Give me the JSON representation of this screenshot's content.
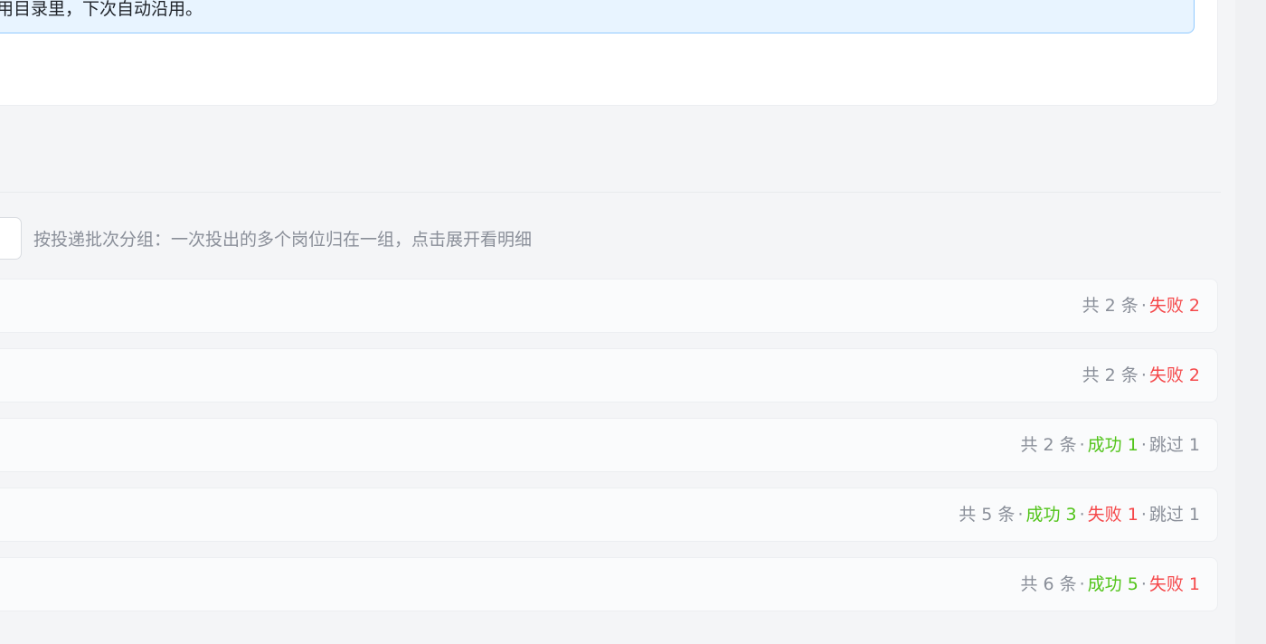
{
  "banner": {
    "text": "用目录里，下次自动沿用。"
  },
  "hint": {
    "text": "按投递批次分组：一次投出的多个岗位归在一组，点击展开看明细"
  },
  "colors": {
    "success": "#52c41a",
    "fail": "#f5484a",
    "muted": "#8a8f99",
    "banner_bg": "#e8f4ff",
    "banner_border": "#91caff"
  },
  "batches": [
    {
      "total": "共 2 条",
      "success": null,
      "fail": "失败 2",
      "skip": null
    },
    {
      "total": "共 2 条",
      "success": null,
      "fail": "失败 2",
      "skip": null
    },
    {
      "total": "共 2 条",
      "success": "成功 1",
      "fail": null,
      "skip": "跳过 1"
    },
    {
      "total": "共 5 条",
      "success": "成功 3",
      "fail": "失败 1",
      "skip": "跳过 1"
    },
    {
      "total": "共 6 条",
      "success": "成功 5",
      "fail": "失败 1",
      "skip": null
    }
  ]
}
